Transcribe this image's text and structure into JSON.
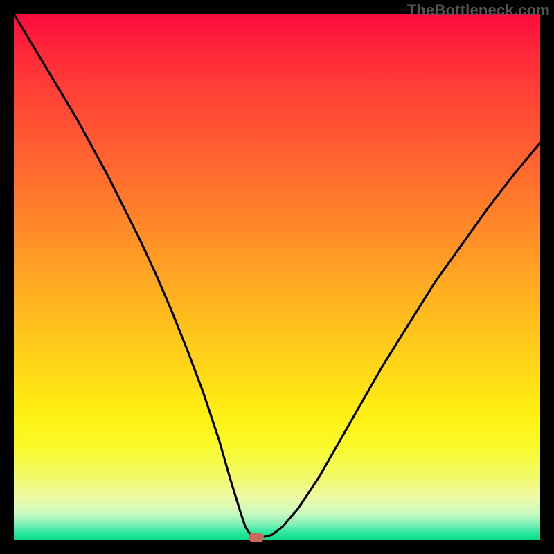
{
  "watermark": "TheBottleneck.com",
  "colors": {
    "frame": "#000000",
    "gradient_top": "#ff0b3f",
    "gradient_bottom": "#0add89",
    "curve": "#000000",
    "marker": "#c96a5c"
  },
  "chart_data": {
    "type": "line",
    "title": "",
    "xlabel": "",
    "ylabel": "",
    "xlim": [
      0,
      100
    ],
    "ylim": [
      0,
      100
    ],
    "x": [
      0,
      3,
      6,
      9,
      12,
      15,
      18,
      21,
      24,
      27,
      30,
      33,
      36,
      39,
      41,
      43,
      44,
      45,
      46,
      47,
      49,
      51,
      54,
      58,
      62,
      66,
      70,
      75,
      80,
      85,
      90,
      95,
      100
    ],
    "values": [
      100,
      95,
      90,
      85,
      80,
      74.5,
      69,
      63,
      57,
      50.5,
      43.5,
      36,
      28,
      19,
      12,
      5.5,
      2.5,
      1,
      0.5,
      0.5,
      1,
      2.5,
      6,
      12,
      19,
      26,
      33,
      41,
      49,
      56,
      63,
      69.5,
      75.5
    ],
    "marker": {
      "x": 46,
      "y": 0.5
    },
    "note": "V-shaped performance curve; minimum near x≈46 indicating optimal balance point."
  }
}
